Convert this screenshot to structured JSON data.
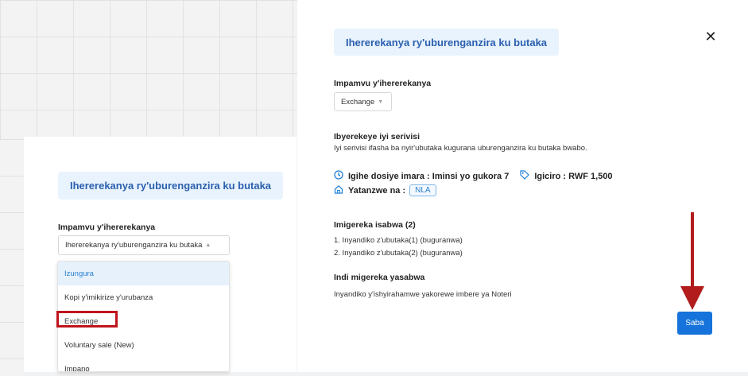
{
  "right_panel": {
    "title": "Ihererekanya ry'uburenganzira ku butaka",
    "close_glyph": "✕",
    "reason_label": "Impamvu y'ihererekanya",
    "reason_value": "Exchange",
    "desc_label": "Ibyerekeye iyi serivisi",
    "desc_text": "Iyi serivisi ifasha ba nyir'ubutaka kugurana uburenganzira ku butaka bwabo.",
    "duration_text": "Igihe dosiye imara : Iminsi yo gukora 7",
    "price_text": "Igiciro : RWF 1,500",
    "approved_label": "Yatanzwe na :",
    "approved_value": "NLA",
    "docs_required_label": "Imigereka isabwa (2)",
    "docs_required": [
      "1. Inyandiko z'ubutaka(1) (buguranwa)",
      "2. Inyandiko z'ubutaka(2) (buguranwa)"
    ],
    "other_docs_label": "Indi migereka yasabwa",
    "other_docs_text": "Inyandiko y'ishyirahamwe yakorewe imbere ya Noteri",
    "submit_label": "Saba"
  },
  "left_panel": {
    "title": "Ihererekanya ry'uburenganzira ku butaka",
    "reason_label": "Impamvu y'ihererekanya",
    "reason_value": "Ihererekanya ry'uburenganzira ku butaka",
    "options": [
      "Izungura",
      "Kopi y'imikirize y'urubanza",
      "Exchange",
      "Voluntary sale (New)",
      "Impano"
    ]
  },
  "icons": {
    "clock": "clock-icon",
    "tag": "tag-icon",
    "home": "home-icon"
  },
  "colors": {
    "accent": "#1673db",
    "title_bg": "#e9f3fd",
    "annotation_red": "#b21c1c"
  }
}
